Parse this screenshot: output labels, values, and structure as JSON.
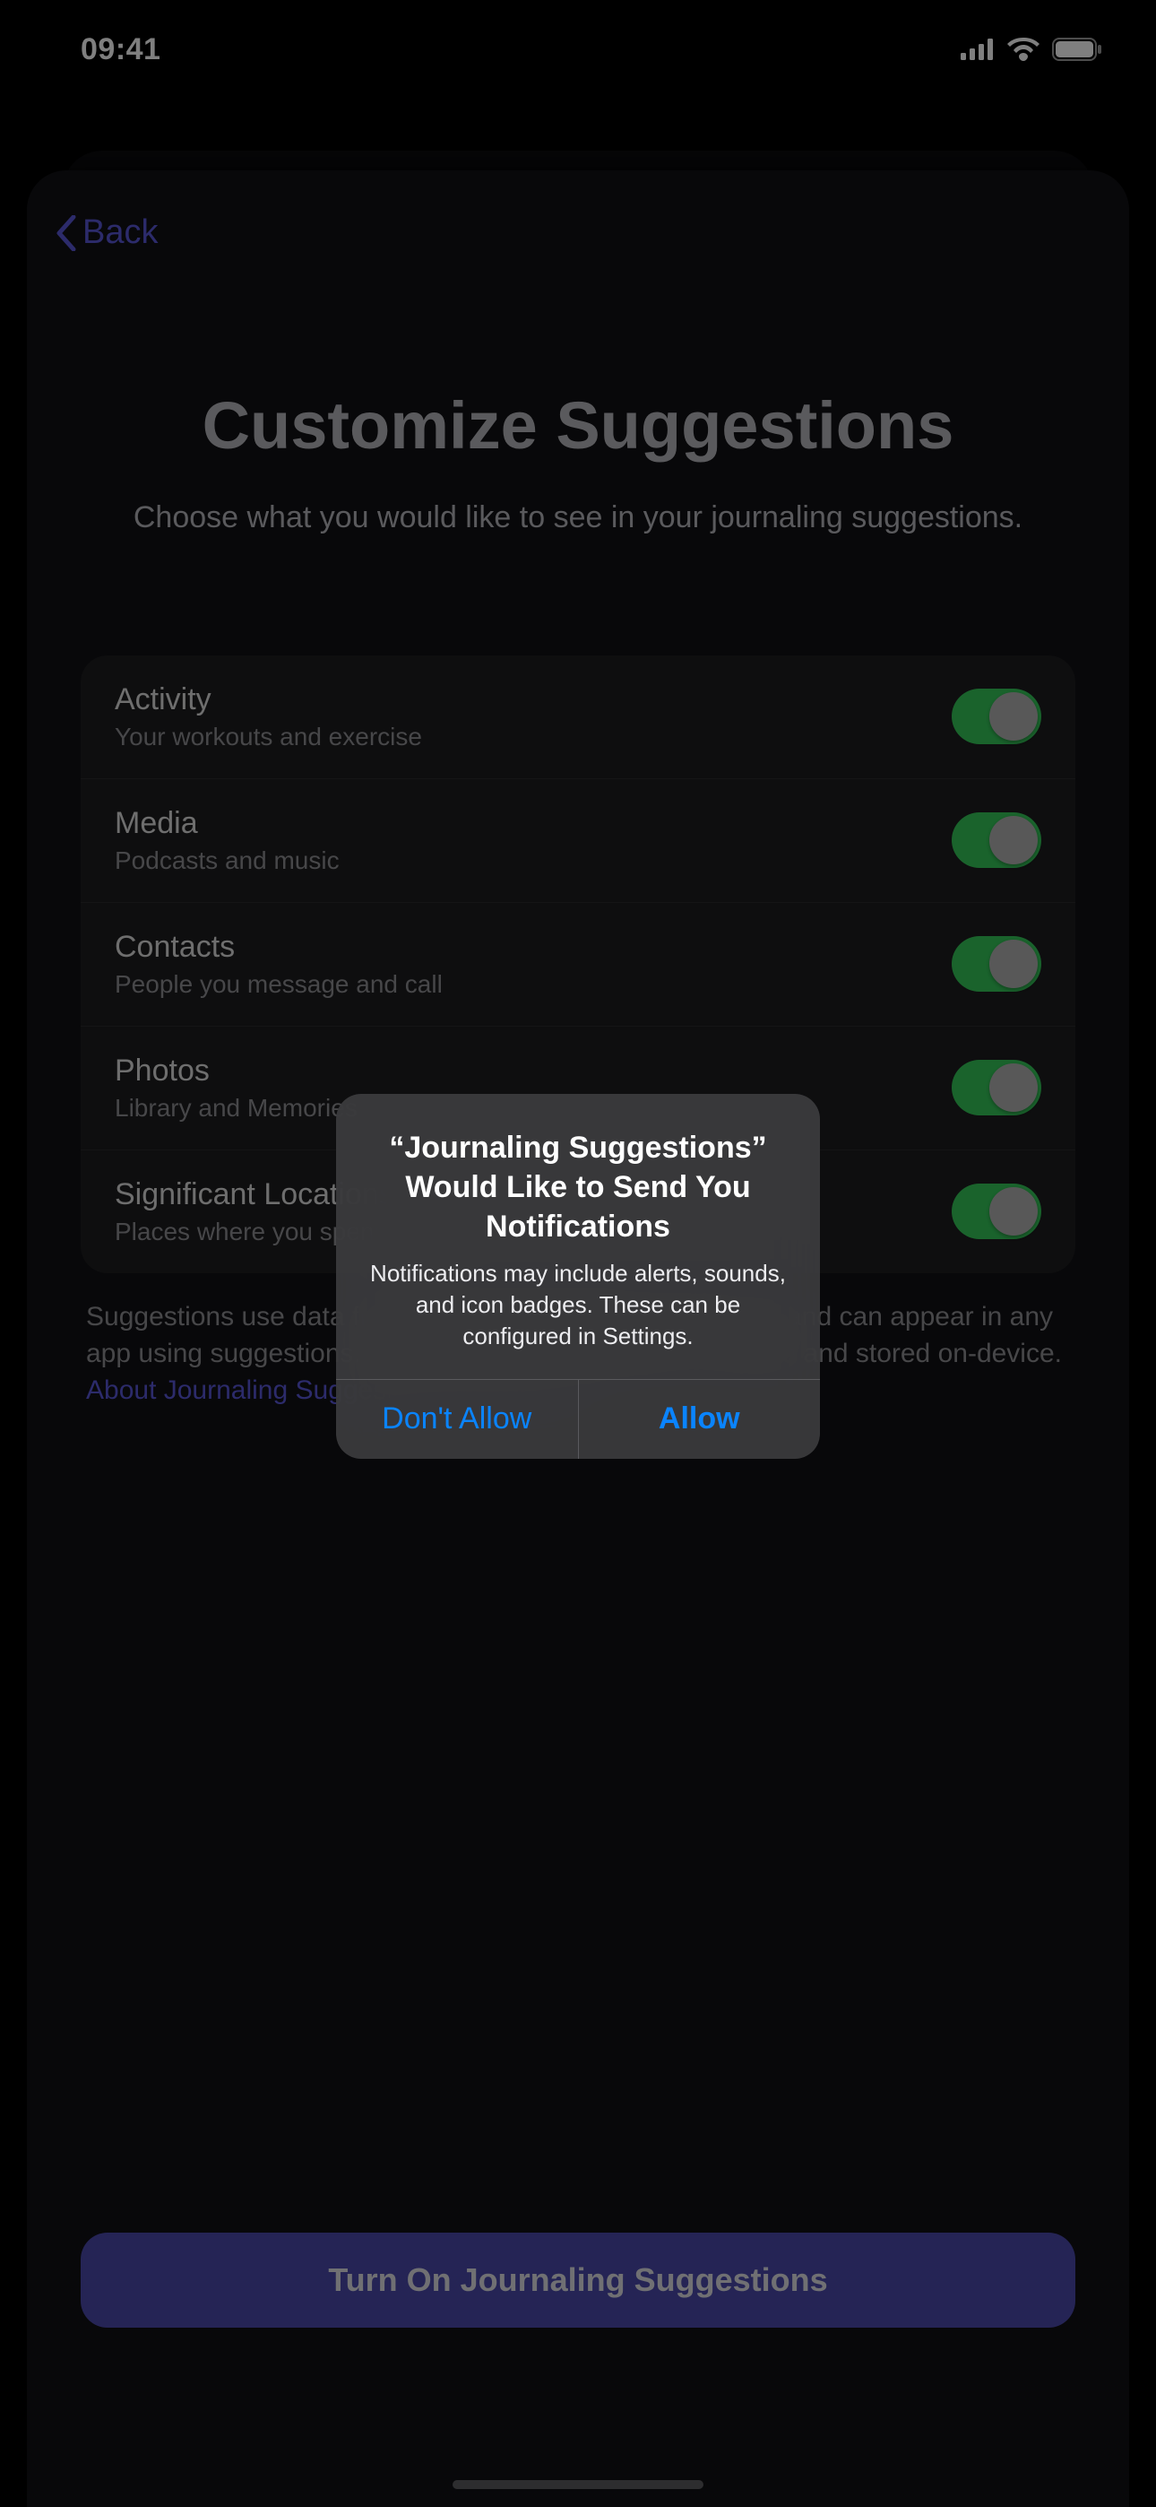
{
  "status": {
    "time": "09:41"
  },
  "nav": {
    "back_label": "Back"
  },
  "page": {
    "title": "Customize Suggestions",
    "subtitle": "Choose what you would like to see in your journaling suggestions."
  },
  "rows": [
    {
      "title": "Activity",
      "subtitle": "Your workouts and exercise",
      "on": true
    },
    {
      "title": "Media",
      "subtitle": "Podcasts and music",
      "on": true
    },
    {
      "title": "Contacts",
      "subtitle": "People you message and call",
      "on": true
    },
    {
      "title": "Photos",
      "subtitle": "Library and Memories",
      "on": true
    },
    {
      "title": "Significant Locations",
      "subtitle": "Places where you spend time",
      "on": true
    }
  ],
  "footer": {
    "text": "Suggestions use data from apps and services you turn on, and can appear in any app using suggestions. Data used for suggestions is private and stored on-device. ",
    "link": "About Journaling Suggestions & Privacy…"
  },
  "cta": {
    "primary": "Turn On Journaling Suggestions"
  },
  "alert": {
    "title": "“Journaling Suggestions” Would Like to Send You Notifications",
    "message": "Notifications may include alerts, sounds, and icon badges. These can be configured in Settings.",
    "dont_allow": "Don't Allow",
    "allow": "Allow"
  }
}
